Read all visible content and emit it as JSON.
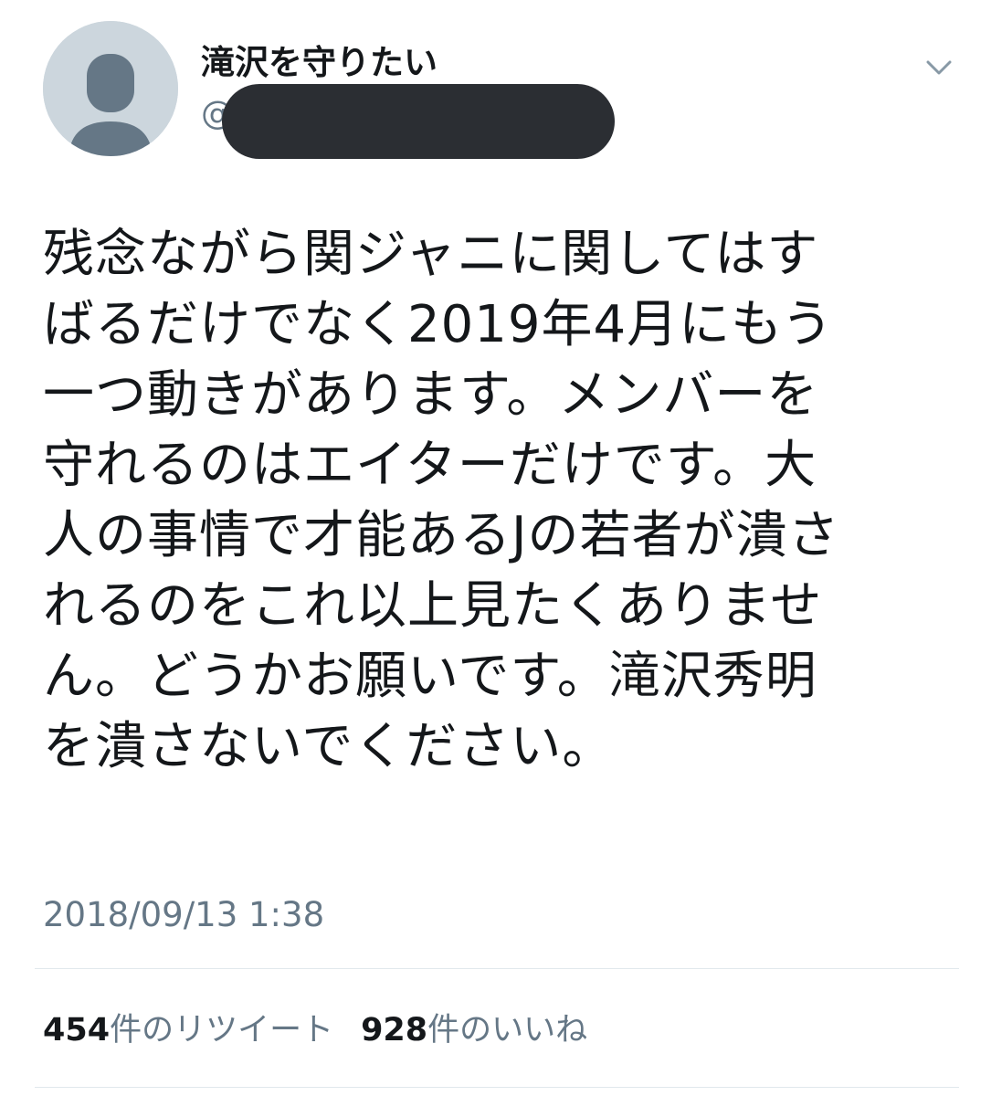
{
  "header": {
    "avatar_icon": "default-profile-icon",
    "display_name": "滝沢を守りたい",
    "handle_prefix": "@",
    "handle_redacted": true,
    "menu_icon": "chevron-down-icon"
  },
  "tweet": {
    "lines": [
      "残念ながら関ジャニに関してはす",
      "ばるだけでなく2019年4月にもう",
      "一つ動きがあります。メンバーを",
      "守れるのはエイターだけです。大",
      "人の事情で才能あるJの若者が潰さ",
      "れるのをこれ以上見たくありませ",
      "ん。どうかお願いです。滝沢秀明",
      "を潰さないでください。"
    ],
    "timestamp": "2018/09/13 1:38"
  },
  "stats": {
    "retweets_count": "454",
    "retweets_label": "件のリツイート",
    "likes_count": "928",
    "likes_label": "件のいいね"
  },
  "colors": {
    "text": "#14171a",
    "secondary": "#657786",
    "avatar_bg": "#ccd6dd",
    "avatar_fg": "#657786",
    "divider": "#e1e8ed",
    "redaction": "#2b2e33"
  }
}
